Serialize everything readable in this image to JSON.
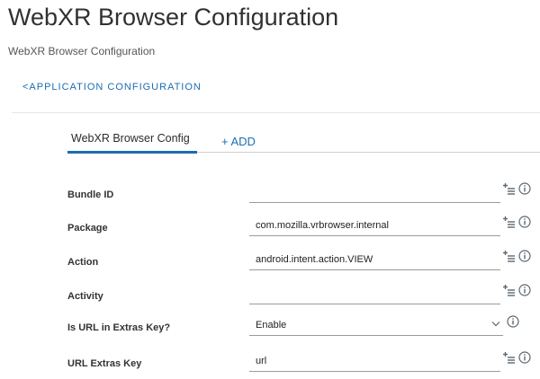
{
  "page": {
    "title": "WebXR Browser Configuration",
    "subtitle": "WebXR Browser Configuration",
    "breadcrumb": "<APPLICATION CONFIGURATION"
  },
  "tabs": {
    "active_label": "WebXR Browser Config",
    "add_label": "+ ADD"
  },
  "fields": [
    {
      "label": "Bundle ID",
      "value": "",
      "type": "text"
    },
    {
      "label": "Package",
      "value": "com.mozilla.vrbrowser.internal",
      "type": "text"
    },
    {
      "label": "Action",
      "value": "android.intent.action.VIEW",
      "type": "text"
    },
    {
      "label": "Activity",
      "value": "",
      "type": "text"
    },
    {
      "label": "Is URL in Extras Key?",
      "value": "Enable",
      "type": "select",
      "options": [
        "Enable"
      ]
    },
    {
      "label": "URL Extras Key",
      "value": "url",
      "type": "text"
    }
  ],
  "icons": {
    "insert_lookup": "insert-lookup-value-icon",
    "info": "info-circle-icon",
    "chevron": "chevron-down-icon"
  },
  "colors": {
    "accent": "#1b6db3",
    "icon": "#5b6670"
  }
}
